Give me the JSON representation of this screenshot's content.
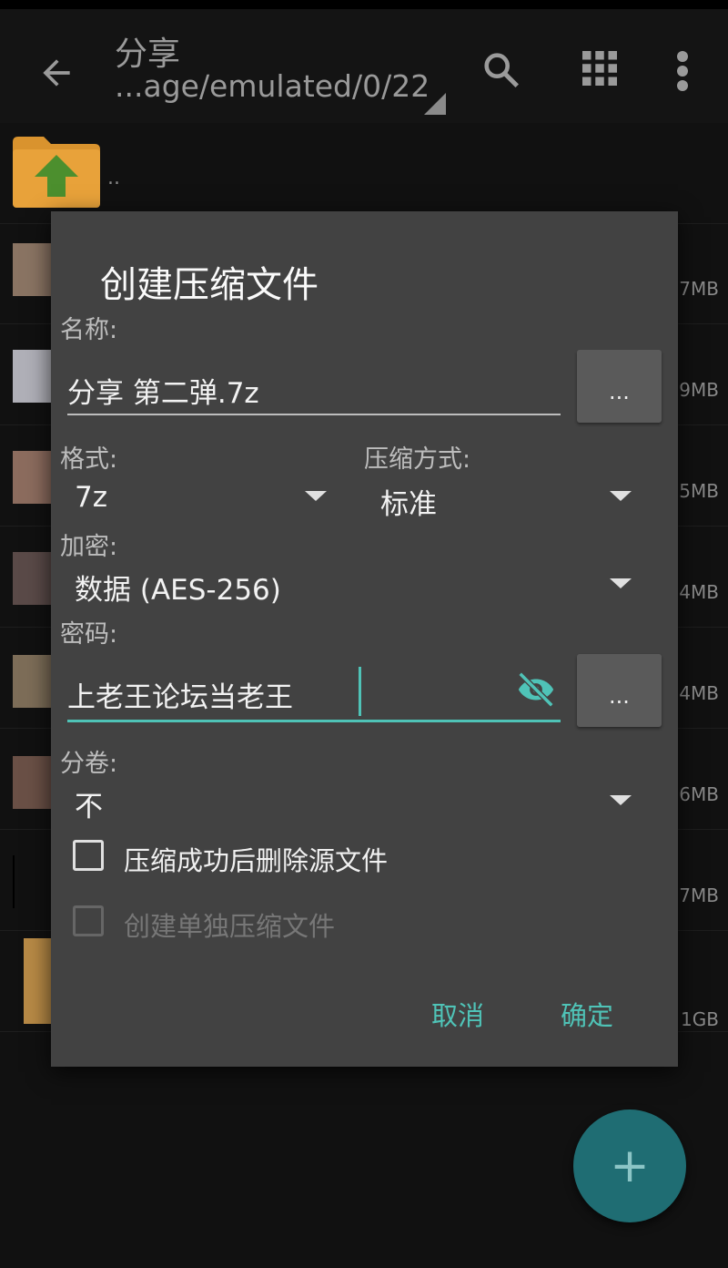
{
  "appbar": {
    "title": "分享",
    "path": "...age/emulated/0/22"
  },
  "list": {
    "parent_label": "..",
    "sizes": [
      "7MB",
      "9MB",
      "5MB",
      "4MB",
      "4MB",
      "6MB",
      "7MB",
      "1GB"
    ]
  },
  "dialog": {
    "title": "创建压缩文件",
    "name_label": "名称:",
    "name_value": "分享 第二弹.7z",
    "browse_label": "...",
    "format_label": "格式:",
    "format_value": "7z",
    "method_label": "压缩方式:",
    "method_value": "标准",
    "encrypt_label": "加密:",
    "encrypt_value": "数据 (AES-256)",
    "password_label": "密码:",
    "password_value": "上老王论坛当老王",
    "password_more_label": "...",
    "volume_label": "分卷:",
    "volume_value": "不",
    "delete_source_label": "压缩成功后删除源文件",
    "separate_archive_label": "创建单独压缩文件",
    "cancel_label": "取消",
    "ok_label": "确定"
  },
  "fab": {
    "icon": "plus-icon",
    "label": "+"
  },
  "colors": {
    "accent": "#4fc3b7",
    "dialog": "#424242",
    "fab": "#1f6d73"
  }
}
